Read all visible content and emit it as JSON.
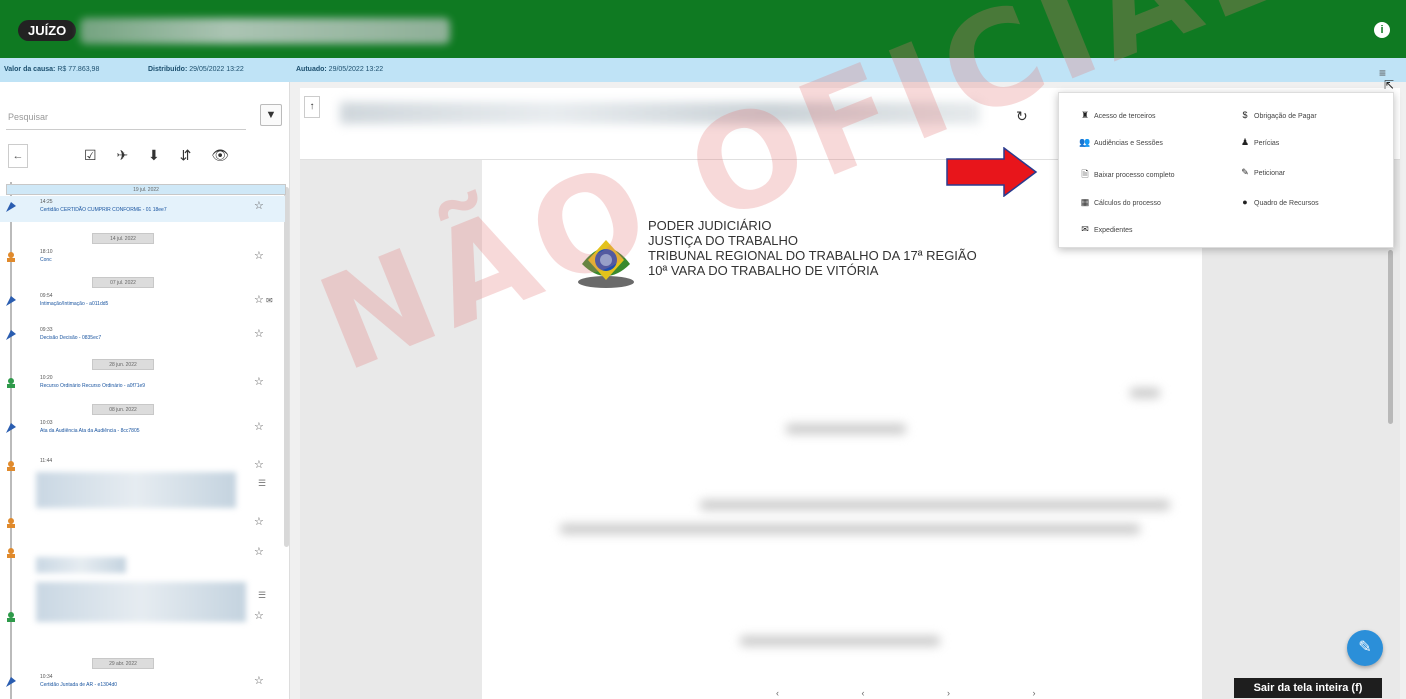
{
  "header": {
    "badge": "JUÍZO",
    "info_icon": "i"
  },
  "infobar": {
    "valor_label": "Valor da causa:",
    "valor_value": "R$ 77.863,98",
    "distribuido_label": "Distribuído:",
    "distribuido_value": "29/05/2022 13:22",
    "autuado_label": "Autuado:",
    "autuado_value": "29/05/2022 13:22",
    "menu_icon": "≡"
  },
  "sidebar": {
    "search_placeholder": "Pesquisar",
    "filter_icon": "▼",
    "back_icon": "←",
    "toolbar_icons": "☑ ✈ ⬇ ⇵ 👁"
  },
  "timeline": {
    "top_date": "19 jul. 2022",
    "items": [
      {
        "time": "14:25",
        "text": "Certidão CERTIDÃO CUMPRIR CONFORME - 01 18ee7",
        "color": "#2a5db0"
      },
      {
        "time": "18:10",
        "text": "Conc",
        "color": "#e08a2c"
      },
      {
        "time": "09:54",
        "text": "Intimação/Intimação - a011dd5",
        "color": "#2a5db0"
      },
      {
        "time": "09:33",
        "text": "Decisão Decisão - 0835ec7",
        "color": "#2a5db0"
      },
      {
        "time": "10:20",
        "text": "Recurso Ordinário Recurso Ordinário - a0f71e9",
        "color": "#2e9a4a"
      },
      {
        "time": "10:03",
        "text": "Ata da Audiência Ata da Audiência - 8cc7805",
        "color": "#2a5db0"
      },
      {
        "time": "11:44",
        "text": "",
        "color": "#e08a2c"
      },
      {
        "time": "10:34",
        "text": "Certidão Juntada de AR - e1304d0",
        "color": "#2a5db0"
      }
    ],
    "date_labels": [
      "14 jul. 2022",
      "07 jul. 2022",
      "28 jun. 2022",
      "08 jun. 2022",
      "29 abr. 2022"
    ]
  },
  "document": {
    "line1": "PODER JUDICIÁRIO",
    "line2": "JUSTIÇA DO TRABALHO",
    "line3": "TRIBUNAL REGIONAL DO TRABALHO DA 17ª REGIÃO",
    "line4": "10ª VARA DO TRABALHO DE VITÓRIA",
    "watermark": "NÃO OFICIAL"
  },
  "menu": {
    "col1": [
      "Acesso de terceiros",
      "Audiências e Sessões",
      "Baixar processo completo",
      "Cálculos do processo",
      "Expedientes"
    ],
    "col2": [
      "Obrigação de Pagar",
      "Perícias",
      "Peticionar",
      "Quadro de Recursos"
    ]
  },
  "footer": {
    "exit_fullscreen": "Sair da tela inteira (f)",
    "fab_icon": "✎"
  },
  "colors": {
    "header_green": "#0f7a22",
    "infobar_blue": "#bfe3f6",
    "arrow_red": "#e8151b",
    "fab_blue": "#2b8fd9"
  }
}
